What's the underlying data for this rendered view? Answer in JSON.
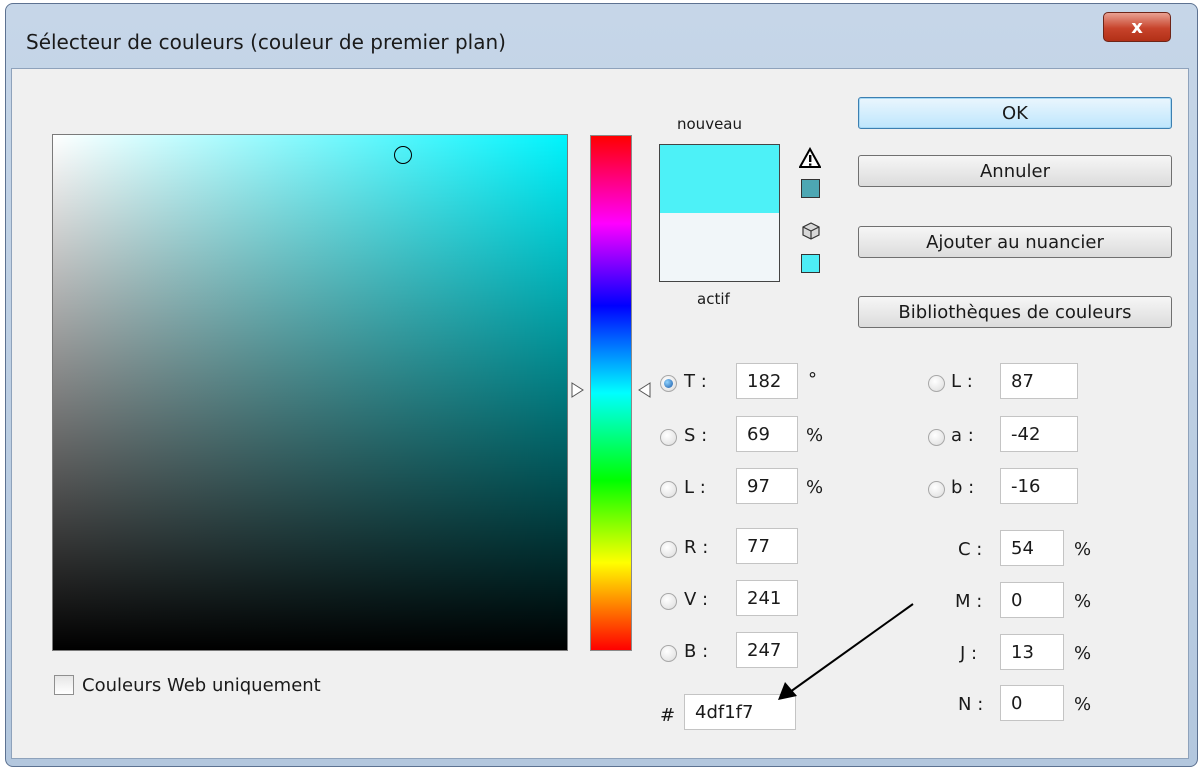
{
  "window": {
    "title": "Sélecteur de couleurs (couleur de premier plan)",
    "close_glyph": "x"
  },
  "swatch": {
    "new_label": "nouveau",
    "current_label": "actif",
    "new_color": "#4df1f7",
    "current_color": "#f1f6f9",
    "gamut_swatch_color": "#4da7b3",
    "websafe_swatch_color": "#4dedf6"
  },
  "buttons": {
    "ok": "OK",
    "cancel": "Annuler",
    "add_swatch": "Ajouter au nuancier",
    "libraries": "Bibliothèques de couleurs"
  },
  "hsb": [
    {
      "key": "T",
      "value": "182",
      "unit": "°",
      "selected": true
    },
    {
      "key": "S",
      "value": "69",
      "unit": "%",
      "selected": false
    },
    {
      "key": "L",
      "value": "97",
      "unit": "%",
      "selected": false
    }
  ],
  "rgb": [
    {
      "key": "R",
      "value": "77"
    },
    {
      "key": "V",
      "value": "241"
    },
    {
      "key": "B",
      "value": "247"
    }
  ],
  "lab": [
    {
      "key": "L",
      "value": "87"
    },
    {
      "key": "a",
      "value": "-42"
    },
    {
      "key": "b",
      "value": "-16"
    }
  ],
  "cmyk": [
    {
      "key": "C",
      "value": "54",
      "unit": "%"
    },
    {
      "key": "M",
      "value": "0",
      "unit": "%"
    },
    {
      "key": "J",
      "value": "13",
      "unit": "%"
    },
    {
      "key": "N",
      "value": "0",
      "unit": "%"
    }
  ],
  "hex": {
    "prefix": "#",
    "value": "4df1f7"
  },
  "web_only": {
    "label": "Couleurs Web uniquement",
    "checked": false
  },
  "colors": {
    "field_hue": "#00f4fd",
    "accent_blue": "#3c7fb1"
  }
}
